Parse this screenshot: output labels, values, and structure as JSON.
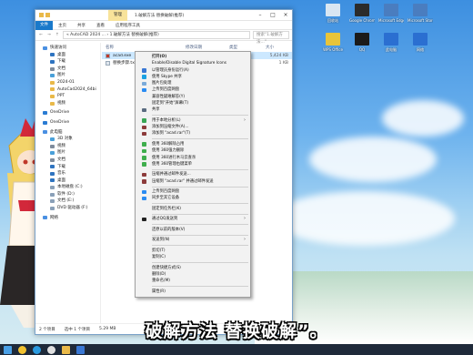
{
  "window": {
    "tab_manage": "管理",
    "title": "1.破解方法 替换破解(推荐)",
    "ribbon": {
      "file": "文件",
      "tabs": [
        "主页",
        "共享",
        "查看",
        "应用程序工具"
      ]
    },
    "address": "« AutoCAD 2024 ...  ›  1.破解方法 替换破解(推荐)",
    "search_placeholder": "搜索\"1.破解方法...\"",
    "columns": {
      "name": "名称",
      "date": "修改日期",
      "type": "类型",
      "size": "大小"
    },
    "files": [
      {
        "name": "acad.exe",
        "size": "5,424 KB",
        "selected": true
      },
      {
        "name": "替换步骤.txt",
        "size": "1 KB",
        "selected": false
      }
    ],
    "nav": [
      {
        "label": "快速访问",
        "level": 0,
        "color": "#4a90e2"
      },
      {
        "label": "桌面",
        "level": 1,
        "color": "#2f74c0"
      },
      {
        "label": "下载",
        "level": 1,
        "color": "#2f74c0"
      },
      {
        "label": "文档",
        "level": 1,
        "color": "#7f8c9c"
      },
      {
        "label": "图片",
        "level": 1,
        "color": "#4aa0d9"
      },
      {
        "label": "2024-01",
        "level": 1,
        "color": "#e9b949"
      },
      {
        "label": "AutoCad2024_64bi",
        "level": 1,
        "color": "#e9b949"
      },
      {
        "label": "PPT",
        "level": 1,
        "color": "#e9b949"
      },
      {
        "label": "视频",
        "level": 1,
        "color": "#e9b949"
      },
      {
        "label": "OneDrive",
        "level": 0,
        "color": "#2b7cd3",
        "gap": true
      },
      {
        "label": "OneDrive",
        "level": 0,
        "color": "#2b7cd3",
        "gap": true
      },
      {
        "label": "此电脑",
        "level": 0,
        "color": "#4a90e2",
        "gap": true
      },
      {
        "label": "3D 对象",
        "level": 1,
        "color": "#4aa0d9"
      },
      {
        "label": "视频",
        "level": 1,
        "color": "#7f8c9c"
      },
      {
        "label": "图片",
        "level": 1,
        "color": "#4aa0d9"
      },
      {
        "label": "文档",
        "level": 1,
        "color": "#7f8c9c"
      },
      {
        "label": "下载",
        "level": 1,
        "color": "#2f74c0"
      },
      {
        "label": "音乐",
        "level": 1,
        "color": "#2f74c0"
      },
      {
        "label": "桌面",
        "level": 1,
        "color": "#2f74c0"
      },
      {
        "label": "本地磁盘 (C:)",
        "level": 1,
        "color": "#8aa0b8"
      },
      {
        "label": "软件 (D:)",
        "level": 1,
        "color": "#8aa0b8"
      },
      {
        "label": "文档 (E:)",
        "level": 1,
        "color": "#8aa0b8"
      },
      {
        "label": "DVD 驱动器 (F:)",
        "level": 1,
        "color": "#8aa0b8"
      },
      {
        "label": "网络",
        "level": 0,
        "color": "#4a90e2",
        "gap": true
      }
    ],
    "status": {
      "count": "2 个项目",
      "selected": "选中 1 个项目",
      "size": "5.29 MB"
    }
  },
  "context_menu": [
    {
      "label": "打开(O)",
      "bold": true
    },
    {
      "label": "Enable/Disable Digital Signature Icons"
    },
    {
      "label": "以管理员身份运行(A)",
      "icon": "shield-icon",
      "color": "#3a78d4"
    },
    {
      "label": "使用 Skype 共享",
      "icon": "skype-icon",
      "color": "#1ba1e2"
    },
    {
      "label": "图片包处理",
      "icon": "image-icon",
      "color": "#7aaad9"
    },
    {
      "label": "上传到百度网盘",
      "icon": "cloud-icon",
      "color": "#2a8bf2"
    },
    {
      "label": "兼容性疑难解答(Y)"
    },
    {
      "label": "固定到\"开始\"屏幕(T)"
    },
    {
      "label": "共享",
      "icon": "share-icon",
      "color": "#5a6b80"
    },
    {
      "sep": true
    },
    {
      "label": "用于本地分析(L)",
      "icon": "bug-icon",
      "color": "#3aa655",
      "arrow": true
    },
    {
      "label": "添加到压缩文件(A)...",
      "icon": "archive-icon",
      "color": "#8c3b3b"
    },
    {
      "label": "添加到 \"acad.rar\"(T)",
      "icon": "archive-icon",
      "color": "#8c3b3b"
    },
    {
      "sep": true
    },
    {
      "label": "使用 360解除占用",
      "icon": "360-icon",
      "color": "#3fae4d"
    },
    {
      "label": "使用 360强力删除",
      "icon": "360-icon",
      "color": "#3fae4d"
    },
    {
      "label": "使用 360进行木马云查杀",
      "icon": "360-icon",
      "color": "#3fae4d"
    },
    {
      "label": "使用 360管理右键菜单",
      "icon": "360-icon",
      "color": "#3fae4d"
    },
    {
      "sep": true
    },
    {
      "label": "压缩并通过邮件发送...",
      "icon": "archive-icon",
      "color": "#8c3b3b"
    },
    {
      "label": "压缩到 \"acad.rar\" 并通过邮件发送",
      "icon": "archive-icon",
      "color": "#8c3b3b"
    },
    {
      "sep": true
    },
    {
      "label": "上传到百度网盘",
      "icon": "cloud-icon",
      "color": "#2a8bf2"
    },
    {
      "label": "同步至其它设备",
      "icon": "sync-icon",
      "color": "#2a8bf2"
    },
    {
      "sep": true
    },
    {
      "label": "固定到任务栏(K)"
    },
    {
      "sep": true
    },
    {
      "label": "通过QQ发送到",
      "icon": "qq-icon",
      "color": "#222222",
      "arrow": true
    },
    {
      "sep": true
    },
    {
      "label": "还原以前的版本(V)"
    },
    {
      "sep": true
    },
    {
      "label": "发送到(N)",
      "arrow": true
    },
    {
      "sep": true
    },
    {
      "label": "剪切(T)"
    },
    {
      "label": "复制(C)"
    },
    {
      "sep": true
    },
    {
      "label": "创建快捷方式(S)"
    },
    {
      "label": "删除(D)"
    },
    {
      "label": "重命名(M)"
    },
    {
      "sep": true
    },
    {
      "label": "属性(R)"
    }
  ],
  "subtitle": "破解方法 替换破解”。",
  "desktop_icons": [
    {
      "label": "回收站",
      "color": "#d9e6f2"
    },
    {
      "label": "Google Chrome",
      "color": "#2b2b2b"
    },
    {
      "label": "Microsoft Edge",
      "color": "#4a7dbf"
    },
    {
      "label": "Microsoft Store",
      "color": "#4a7dbf"
    },
    {
      "label": "WPS Office",
      "color": "#e8c43a"
    },
    {
      "label": "QQ",
      "color": "#1b1b1b"
    },
    {
      "label": "此电脑",
      "color": "#2b6fd1"
    },
    {
      "label": "网络",
      "color": "#2b6fd1"
    }
  ]
}
